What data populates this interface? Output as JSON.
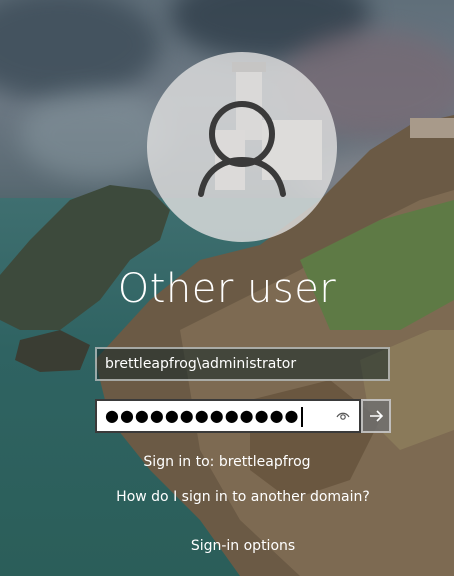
{
  "account": {
    "title": "Other user",
    "avatar_icon": "user-silhouette-icon"
  },
  "form": {
    "username_value": "brettleapfrog\\administrator",
    "password_mask": "●●●●●●●●●●●●●",
    "reveal_icon": "eye-icon",
    "submit_icon": "arrow-right-icon"
  },
  "footer": {
    "sign_in_to": "Sign in to: brettleapfrog",
    "other_domain_link": "How do I sign in to another domain?",
    "sign_in_options": "Sign-in options"
  },
  "colors": {
    "text": "#ffffff",
    "password_bg": "#ffffff",
    "submit_bg": "#6e6e6e"
  }
}
